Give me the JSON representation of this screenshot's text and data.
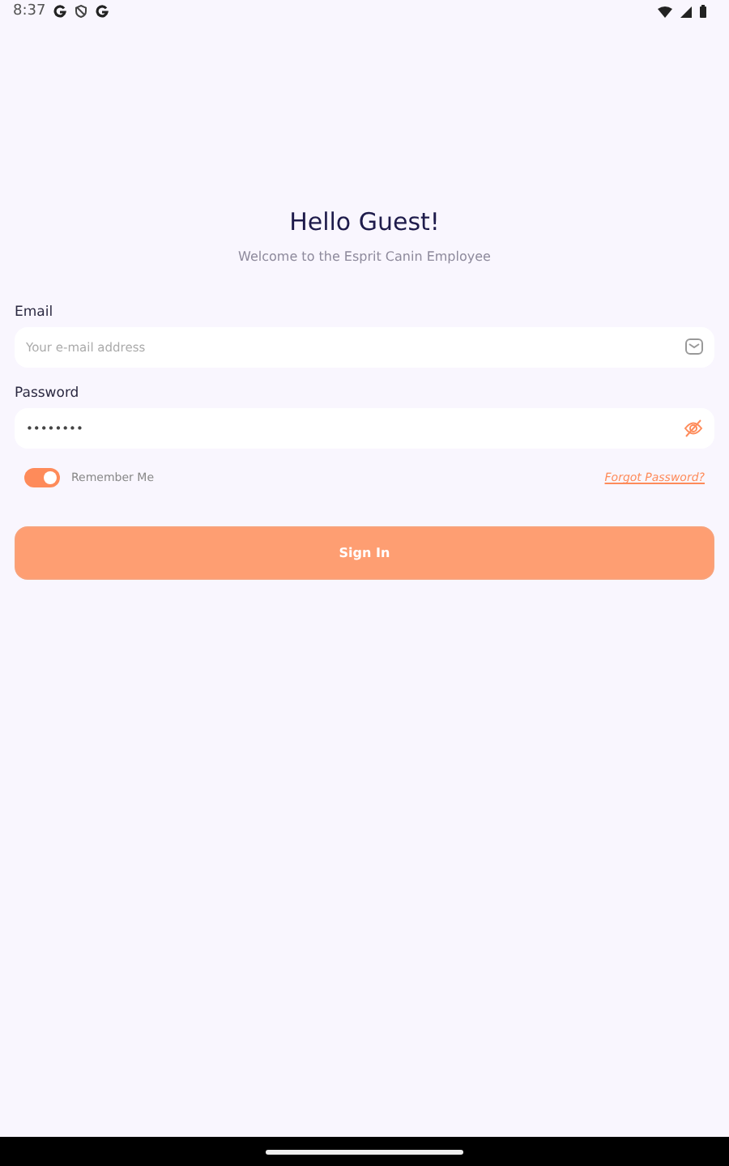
{
  "status_bar": {
    "time": "8:37"
  },
  "header": {
    "title": "Hello Guest!",
    "subtitle": "Welcome to the Esprit Canin Employee"
  },
  "email": {
    "label": "Email",
    "placeholder": "Your e-mail address"
  },
  "password": {
    "label": "Password",
    "value": "••••••••"
  },
  "remember": {
    "label": "Remember Me",
    "on": true
  },
  "forgot_link": "Forgot Password?",
  "sign_in_button": "Sign In"
}
